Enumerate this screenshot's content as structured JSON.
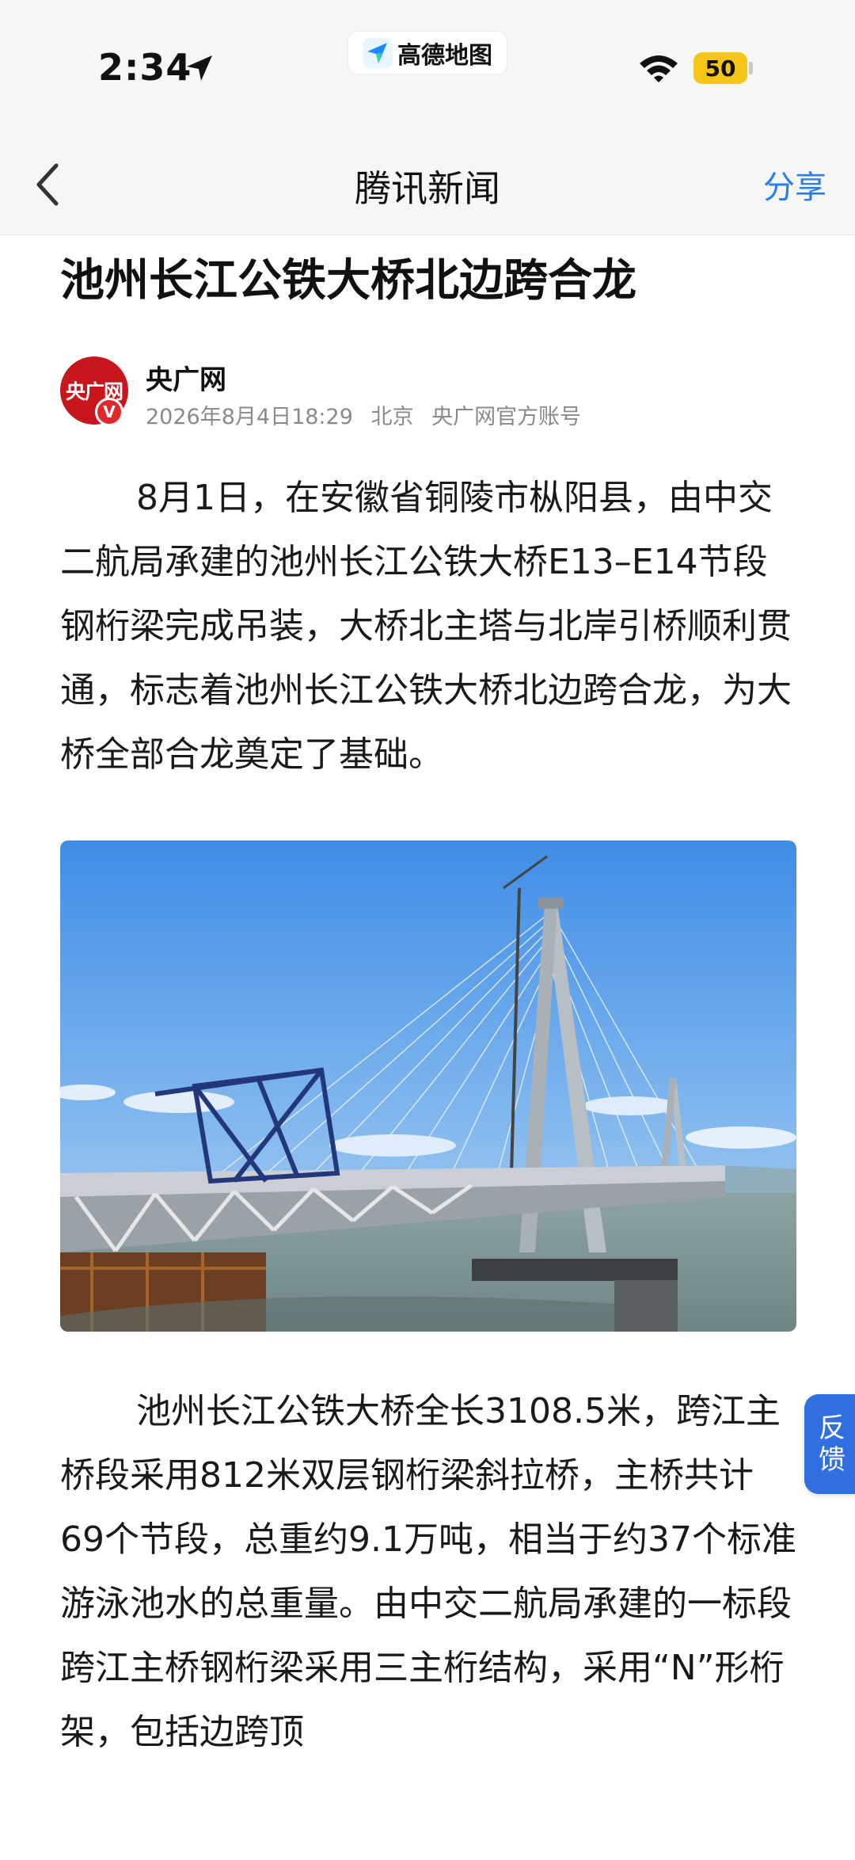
{
  "status_bar": {
    "time": "2:34",
    "app_name": "高德地图",
    "battery_level": "50",
    "icons": [
      "location-arrow-icon",
      "wifi-icon",
      "battery-icon"
    ],
    "battery_color": "#f5c518"
  },
  "nav": {
    "back_icon": "chevron-left-icon",
    "title": "腾讯新闻",
    "share_label": "分享",
    "share_color": "#2b7de9"
  },
  "article": {
    "title": "池州长江公铁大桥北边跨合龙",
    "author": {
      "name": "央广网",
      "avatar_text": "央广网",
      "verified_mark": "V"
    },
    "meta": {
      "date": "2026年8月4日18:29",
      "location": "北京",
      "account_type": "央广网官方账号"
    },
    "paragraphs": [
      "8月1日，在安徽省铜陵市枞阳县，由中交二航局承建的池州长江公铁大桥E13–E14节段钢桁梁完成吊装，大桥北主塔与北岸引桥顺利贯通，标志着池州长江公铁大桥北边跨合龙，为大桥全部合龙奠定了基础。",
      "池州长江公铁大桥全长3108.5米，跨江主桥段采用812米双层钢桁梁斜拉桥，主桥共计69个节段，总重约9.1万吨，相当于约37个标准游泳池水的总重量。由中交二航局承建的一标段跨江主桥钢桁梁采用三主桁结构，采用“N”形桁架，包括边跨顶"
    ]
  },
  "feedback": {
    "label_top": "反",
    "label_bottom": "馈",
    "color": "#2f6fe0"
  }
}
